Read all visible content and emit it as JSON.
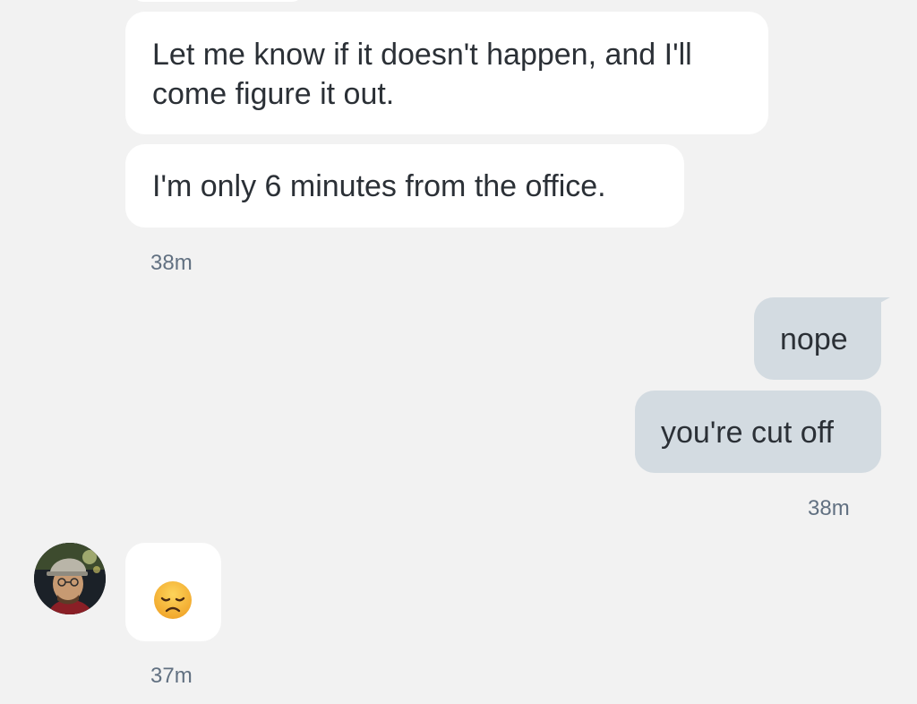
{
  "conversation": {
    "messages": [
      {
        "sender": "them",
        "text": "Let me know if it doesn't happen, and I'll come figure it out."
      },
      {
        "sender": "them",
        "text": "I'm only 6 minutes from the office."
      },
      {
        "sender": "me",
        "text": "nope"
      },
      {
        "sender": "me",
        "text": "you're cut off"
      },
      {
        "sender": "them",
        "emoji": "disappointed-face"
      }
    ],
    "timestamps": [
      "38m",
      "38m",
      "37m"
    ]
  },
  "contact": {
    "avatar": "contact-avatar-photo"
  },
  "colors": {
    "background": "#f2f2f2",
    "incoming_bubble": "#ffffff",
    "outgoing_bubble": "#d3dbe1",
    "message_text": "#2b3036",
    "timestamp_text": "#617081",
    "emoji_face": "#f6b93b"
  }
}
